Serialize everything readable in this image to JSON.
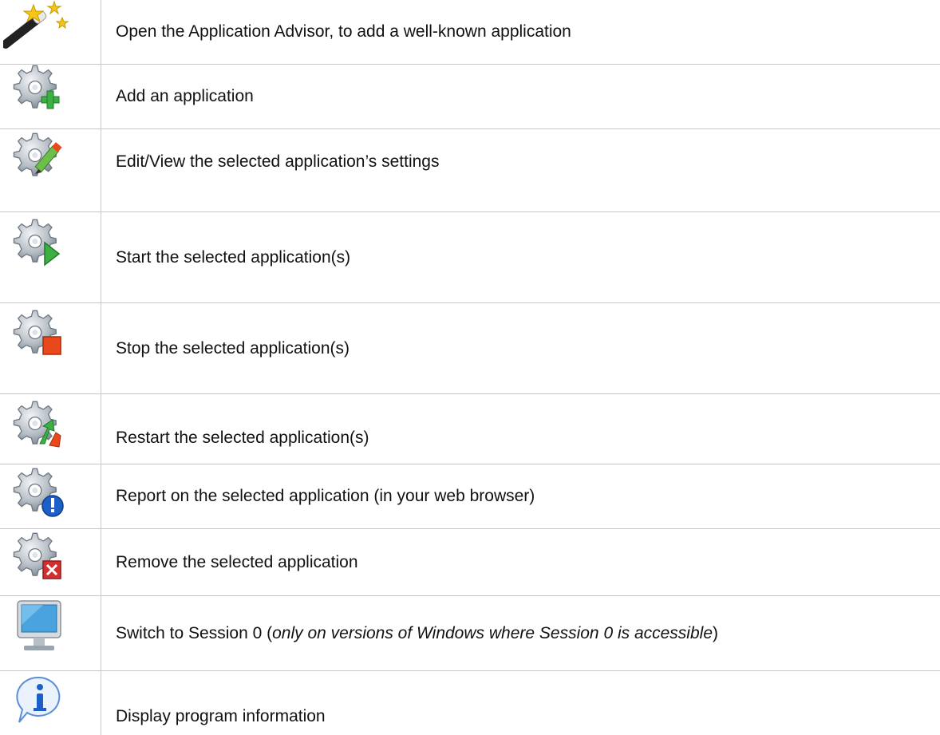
{
  "rows": [
    {
      "icon": "magic-wand-icon",
      "text": "Open the Application Advisor, to add a well-known application"
    },
    {
      "icon": "gear-add-icon",
      "text": "Add an application"
    },
    {
      "icon": "gear-edit-icon",
      "text": "Edit/View the selected application’s settings"
    },
    {
      "icon": "gear-start-icon",
      "text": "Start the selected application(s)"
    },
    {
      "icon": "gear-stop-icon",
      "text": "Stop the selected application(s)"
    },
    {
      "icon": "gear-restart-icon",
      "text": "Restart the selected application(s)"
    },
    {
      "icon": "gear-report-icon",
      "text": "Report on the selected application (in your web browser)"
    },
    {
      "icon": "gear-remove-icon",
      "text": "Remove the selected application"
    },
    {
      "icon": "monitor-icon",
      "text_prefix": "Switch to Session 0 (",
      "text_italic": "only on versions of Windows where Session 0 is accessible",
      "text_suffix": ")"
    },
    {
      "icon": "info-icon",
      "text": "Display program information"
    }
  ],
  "colors": {
    "border": "#c8c8c8",
    "gear": "#9aa4ae",
    "add": "#3cb043",
    "start": "#3cb043",
    "stop": "#e8481c",
    "report": "#1d5fc9",
    "remove": "#d32f2f",
    "star": "#f5c518",
    "monitor_screen": "#4aa3df"
  }
}
